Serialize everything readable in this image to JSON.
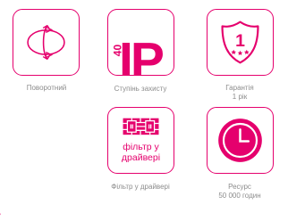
{
  "colors": {
    "accent": "#e5006d",
    "caption": "#8c8c8c"
  },
  "features": [
    {
      "icon": "rotation-sphere-icon",
      "caption": "Поворотний"
    },
    {
      "icon": "ip-rating-icon",
      "ip_code": "IP",
      "ip_number": "40",
      "caption": "Ступінь захисту"
    },
    {
      "icon": "warranty-shield-icon",
      "badge_number": "1",
      "caption_line1": "Гарантія",
      "caption_line2": "1 рік"
    },
    {
      "icon": "driver-filter-icon",
      "tile_text_line1": "фільтр у",
      "tile_text_line2": "драйвері",
      "caption": "Фільтр у драйвері"
    },
    {
      "icon": "clock-icon",
      "caption_line1": "Ресурс",
      "caption_line2": "50 000 годин"
    }
  ]
}
